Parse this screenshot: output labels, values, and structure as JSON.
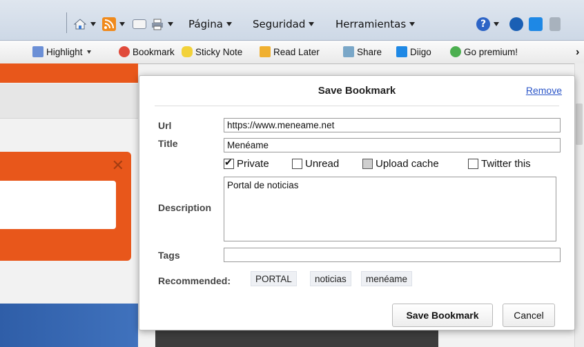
{
  "ie_toolbar": {
    "page_label": "Página",
    "security_label": "Seguridad",
    "tools_label": "Herramientas",
    "icons": [
      "home-icon",
      "rss-feed-icon",
      "read-mail-icon",
      "print-icon",
      "help-icon",
      "hp-logo-icon",
      "diigo-logo-icon",
      "research-icon"
    ]
  },
  "diigo_toolbar": {
    "items": [
      {
        "label": "Highlight",
        "icon": "highlighter-icon"
      },
      {
        "label": "Bookmark",
        "icon": "bookmark-icon"
      },
      {
        "label": "Sticky Note",
        "icon": "sticky-note-icon"
      },
      {
        "label": "Read Later",
        "icon": "read-later-icon"
      },
      {
        "label": "Share",
        "icon": "share-icon"
      },
      {
        "label": "Diigo",
        "icon": "diigo-icon"
      },
      {
        "label": "Go premium!",
        "icon": "premium-icon"
      }
    ]
  },
  "dialog": {
    "title": "Save Bookmark",
    "remove_label": "Remove",
    "url_label": "Url",
    "url_value": "https://www.meneame.net",
    "title_label": "Title",
    "title_value": "Menéame",
    "checkboxes": [
      {
        "label": "Private",
        "checked": true
      },
      {
        "label": "Unread",
        "checked": false
      },
      {
        "label": "Upload cache",
        "checked": false
      },
      {
        "label": "Twitter this",
        "checked": false
      }
    ],
    "description_label": "Description",
    "description_value": "Portal de noticias",
    "tags_label": "Tags",
    "tags_value": "",
    "recommended_label": "Recommended:",
    "recommended_tags": [
      "PORTAL",
      "noticias",
      "menéame"
    ],
    "save_label": "Save Bookmark",
    "cancel_label": "Cancel"
  },
  "colors": {
    "page_accent": "#e8571b",
    "link": "#2a55c8"
  }
}
